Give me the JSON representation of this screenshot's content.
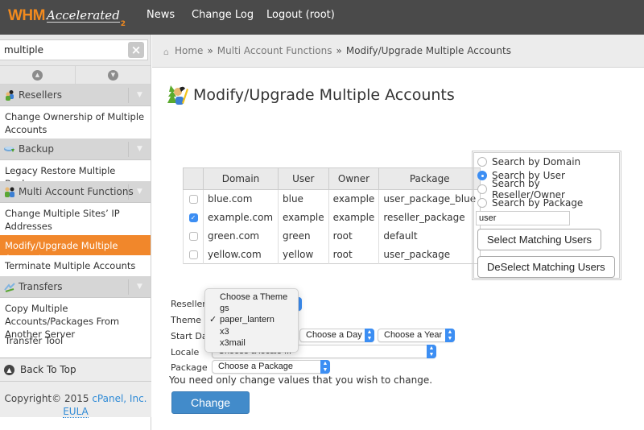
{
  "header": {
    "logo_main": "WHM",
    "logo_sub": "Accelerated",
    "logo_version": "2",
    "nav": [
      "News",
      "Change Log",
      "Logout (root)"
    ]
  },
  "sidebar": {
    "search_value": "multiple",
    "clear_icon": "×",
    "sections": [
      {
        "label": "Resellers",
        "icon": "resellers-icon",
        "items": [
          {
            "label": "Change Ownership of Multiple Accounts",
            "active": false
          }
        ]
      },
      {
        "label": "Backup",
        "icon": "backup-icon",
        "items": [
          {
            "label": "Legacy Restore Multiple Backups",
            "active": false
          }
        ]
      },
      {
        "label": "Multi Account Functions",
        "icon": "multi-account-icon",
        "items": [
          {
            "label": "Change Multiple Sites’ IP Addresses",
            "active": false
          },
          {
            "label": "Modify/Upgrade Multiple Accounts",
            "active": true
          },
          {
            "label": "Terminate Multiple Accounts",
            "active": false
          }
        ]
      },
      {
        "label": "Transfers",
        "icon": "transfers-icon",
        "items": [
          {
            "label": "Copy Multiple Accounts/Packages From Another Server",
            "active": false
          },
          {
            "label": "Transfer Tool",
            "active": false
          }
        ]
      }
    ],
    "back_to_top": "Back To Top",
    "copyright": "Copyright© 2015",
    "company_link": "cPanel, Inc.",
    "eula_link": "EULA"
  },
  "breadcrumb": {
    "home": "Home",
    "section": "Multi Account Functions",
    "current": "Modify/Upgrade Multiple Accounts",
    "separator": "»"
  },
  "page": {
    "title": "Modify/Upgrade Multiple Accounts"
  },
  "accounts_table": {
    "columns": [
      "Domain",
      "User",
      "Owner",
      "Package"
    ],
    "rows": [
      {
        "checked": false,
        "domain": "blue.com",
        "user": "blue",
        "owner": "example",
        "package": "user_package_blue"
      },
      {
        "checked": true,
        "domain": "example.com",
        "user": "example",
        "owner": "example",
        "package": "reseller_package"
      },
      {
        "checked": false,
        "domain": "green.com",
        "user": "green",
        "owner": "root",
        "package": "default"
      },
      {
        "checked": false,
        "domain": "yellow.com",
        "user": "yellow",
        "owner": "root",
        "package": "user_package"
      }
    ]
  },
  "search_panel": {
    "options": [
      {
        "label": "Search by Domain",
        "selected": false
      },
      {
        "label": "Search by User",
        "selected": true
      },
      {
        "label": "Search by Reseller/Owner",
        "selected": false
      },
      {
        "label": "Search by Package",
        "selected": false
      }
    ],
    "input_value": "user",
    "select_button": "Select Matching Users",
    "deselect_button": "DeSelect Matching Users"
  },
  "form": {
    "reseller_label": "Reseller",
    "theme_label": "Theme",
    "start_date_label": "Start Dat",
    "locale_label": "Locale",
    "package_label": "Package",
    "day_select": "Choose a Day",
    "year_select": "Choose a Year",
    "locale_select": "Choose a locale ...",
    "package_select": "Choose a Package",
    "note": "You need only change values that you wish to change.",
    "change_button": "Change"
  },
  "theme_dropdown": {
    "options": [
      "Choose a Theme",
      "gs",
      "paper_lantern",
      "x3",
      "x3mail"
    ],
    "selected": "paper_lantern",
    "check_glyph": "✓"
  },
  "colors": {
    "header_bg": "#4a4a4a",
    "brand_orange": "#f28a1e",
    "active_item": "#f1872b",
    "primary_button": "#428bca",
    "link": "#2e8ad6",
    "select_accent": "#3c8ef3"
  }
}
